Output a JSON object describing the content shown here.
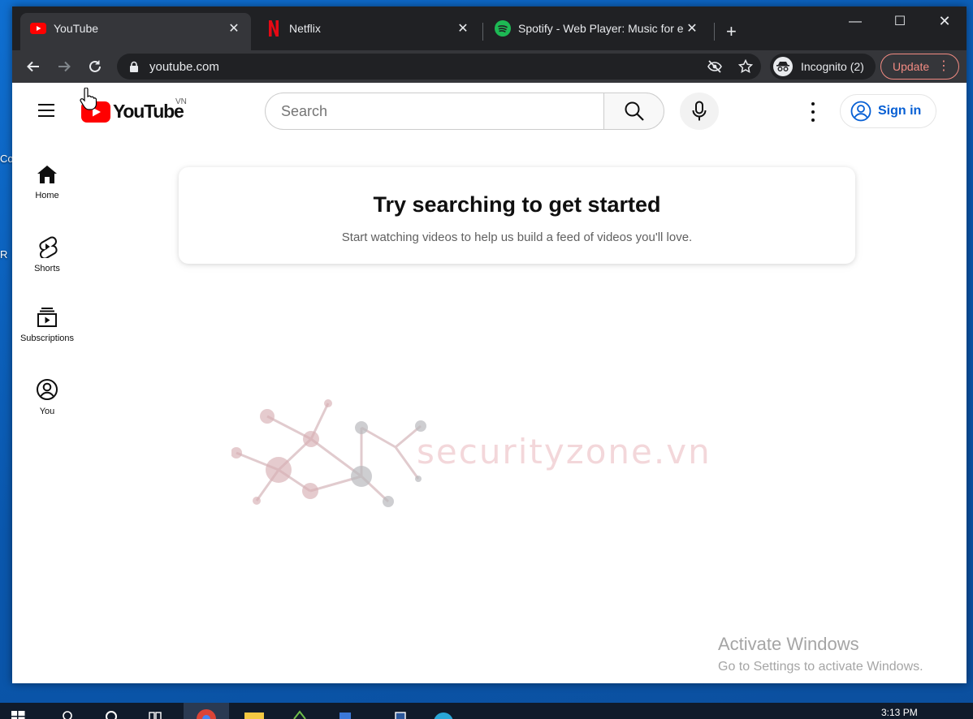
{
  "desktop": {
    "fragment1": "Co",
    "fragment2": "R"
  },
  "browser": {
    "tabs": [
      {
        "title": "YouTube",
        "icon": "youtube-icon",
        "active": true
      },
      {
        "title": "Netflix",
        "icon": "netflix-icon",
        "active": false
      },
      {
        "title": "Spotify - Web Player: Music for e",
        "icon": "spotify-icon",
        "active": false
      }
    ],
    "url": "youtube.com",
    "incognito_label": "Incognito (2)",
    "update_label": "Update"
  },
  "youtube": {
    "logo_text": "YouTube",
    "country_code": "VN",
    "search_placeholder": "Search",
    "sign_in_label": "Sign in",
    "guide": [
      {
        "label": "Home",
        "icon": "home-icon"
      },
      {
        "label": "Shorts",
        "icon": "shorts-icon"
      },
      {
        "label": "Subscriptions",
        "icon": "subscriptions-icon"
      },
      {
        "label": "You",
        "icon": "you-icon"
      }
    ],
    "empty_title": "Try searching to get started",
    "empty_subtitle": "Start watching videos to help us build a feed of videos you'll love."
  },
  "watermark": {
    "text": "securityzone.vn"
  },
  "activation": {
    "title": "Activate Windows",
    "subtitle": "Go to Settings to activate Windows."
  },
  "taskbar": {
    "time": "3:13 PM"
  },
  "colors": {
    "youtube_red": "#ff0000",
    "link_blue": "#065fd4",
    "chrome_dark": "#202124",
    "chrome_toolbar": "#35363a",
    "update_red": "#f28b82",
    "spotify_green": "#1db954",
    "netflix_red": "#e50914"
  }
}
